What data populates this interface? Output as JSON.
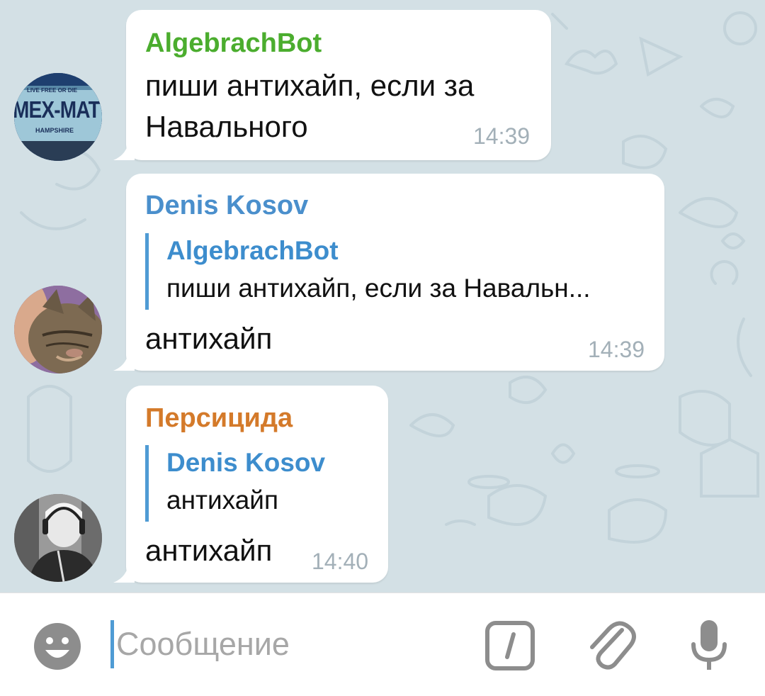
{
  "messages": [
    {
      "sender": "AlgebrachBot",
      "sender_color": "#4bad2e",
      "text_lines": [
        "пиши антихайп, если за",
        "Навального"
      ],
      "time": "14:39",
      "avatar": "mex-mat-license-plate"
    },
    {
      "sender": "Denis Kosov",
      "sender_color": "#4a8fcc",
      "reply": {
        "name": "AlgebrachBot",
        "text": "пиши антихайп, если за Навальн..."
      },
      "text": "антихайп",
      "time": "14:39",
      "avatar": "cat-photo"
    },
    {
      "sender": "Персицида",
      "sender_color": "#d47a2a",
      "reply": {
        "name": "Denis Kosov",
        "text": "антихайп"
      },
      "text": "антихайп",
      "time": "14:40",
      "avatar": "person-with-headphones"
    }
  ],
  "avatar_plate_text": {
    "top": "LIVE FREE OR DIE",
    "main": "MEX-MAT",
    "bottom": "HAMPSHIRE"
  },
  "input": {
    "placeholder": "Сообщение"
  },
  "icons": {
    "emoji": "emoji-icon",
    "bot_command": "slash-command-icon",
    "attach": "paperclip-icon",
    "voice": "microphone-icon"
  },
  "colors": {
    "accent": "#4f9bd4",
    "bubble": "#ffffff",
    "chat_background": "#d3e0e5"
  }
}
